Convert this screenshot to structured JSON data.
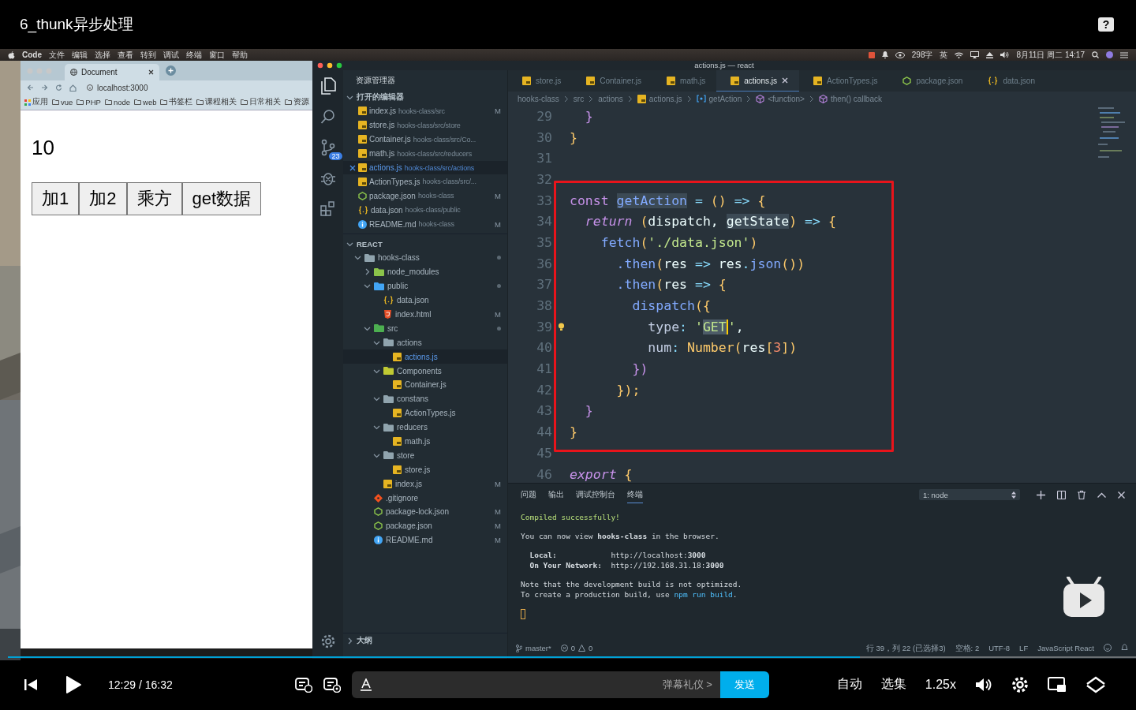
{
  "player": {
    "title": "6_thunk异步处理",
    "help": "?",
    "playing": false,
    "progress": {
      "level": 0.755
    },
    "time": "12:29 / 16:32",
    "danmaku_hint": "弹幕礼仪 >",
    "send": "发送",
    "options": [
      "自动",
      "选集",
      "1.25x"
    ]
  },
  "menubar": {
    "app": "Code",
    "menus": [
      "文件",
      "编辑",
      "选择",
      "查看",
      "转到",
      "调试",
      "终端",
      "窗口",
      "帮助"
    ],
    "word_count": "298字",
    "input_method": "英",
    "clock": "8月11日 周二 14:17"
  },
  "browser": {
    "tab": "Document",
    "url": "localhost:3000",
    "bookmarks": [
      {
        "kind": "apps",
        "label": "应用"
      },
      {
        "kind": "folder",
        "label": "vue"
      },
      {
        "kind": "folder",
        "label": "PHP"
      },
      {
        "kind": "folder",
        "label": "node"
      },
      {
        "kind": "folder",
        "label": "web"
      },
      {
        "kind": "folder",
        "label": "书签栏"
      },
      {
        "kind": "folder",
        "label": "课程相关"
      },
      {
        "kind": "folder",
        "label": "日常相关"
      },
      {
        "kind": "folder",
        "label": "资源"
      }
    ],
    "count": "10",
    "buttons": [
      "加1",
      "加2",
      "乘方",
      "get数据"
    ]
  },
  "vscode": {
    "title": "actions.js — react",
    "source_control_badge": "23",
    "explorer": {
      "title": "资源管理器",
      "open_editors_title": "打开的编辑器",
      "open_editors_expanded": true,
      "open_editors": [
        {
          "name": "index.js",
          "path": "hooks-class/src",
          "kind": "js",
          "status": "M",
          "selected": false
        },
        {
          "name": "store.js",
          "path": "hooks-class/src/store",
          "kind": "js",
          "selected": false
        },
        {
          "name": "Container.js",
          "path": "hooks-class/src/Co...",
          "kind": "js",
          "selected": false
        },
        {
          "name": "math.js",
          "path": "hooks-class/src/reducers",
          "kind": "js",
          "selected": false
        },
        {
          "name": "actions.js",
          "path": "hooks-class/src/actions",
          "kind": "js",
          "selected": true
        },
        {
          "name": "ActionTypes.js",
          "path": "hooks-class/src/...",
          "kind": "js",
          "selected": false
        },
        {
          "name": "package.json",
          "path": "hooks-class",
          "kind": "npm",
          "status": "M",
          "selected": false
        },
        {
          "name": "data.json",
          "path": "hooks-class/public",
          "kind": "data",
          "selected": false
        },
        {
          "name": "README.md",
          "path": "hooks-class",
          "kind": "info",
          "status": "M",
          "selected": false
        }
      ],
      "project_title": "REACT",
      "project_expanded": true,
      "tree": [
        {
          "name": "hooks-class",
          "kind": "folder",
          "color": "#90a4ae",
          "expanded": true,
          "modified": true,
          "selected": false,
          "children": [
            {
              "name": "node_modules",
              "kind": "folder",
              "color": "#8bc34a",
              "expanded": false,
              "modified": false,
              "selected": false
            },
            {
              "name": "public",
              "kind": "folder",
              "color": "#42a5f5",
              "expanded": true,
              "modified": true,
              "selected": false,
              "children": [
                {
                  "name": "data.json",
                  "kind": "data",
                  "selected": false
                },
                {
                  "name": "index.html",
                  "kind": "html",
                  "status": "M",
                  "selected": false
                }
              ]
            },
            {
              "name": "src",
              "kind": "folder",
              "color": "#4caf50",
              "expanded": true,
              "modified": true,
              "selected": false,
              "children": [
                {
                  "name": "actions",
                  "kind": "folder",
                  "color": "#90a4ae",
                  "expanded": true,
                  "modified": false,
                  "selected": false,
                  "children": [
                    {
                      "name": "actions.js",
                      "kind": "js",
                      "selected": true
                    }
                  ]
                },
                {
                  "name": "Components",
                  "kind": "folder",
                  "color": "#c0ca33",
                  "expanded": true,
                  "modified": false,
                  "selected": false,
                  "children": [
                    {
                      "name": "Container.js",
                      "kind": "js",
                      "selected": false
                    }
                  ]
                },
                {
                  "name": "constans",
                  "kind": "folder",
                  "color": "#90a4ae",
                  "expanded": true,
                  "modified": false,
                  "selected": false,
                  "children": [
                    {
                      "name": "ActionTypes.js",
                      "kind": "js",
                      "selected": false
                    }
                  ]
                },
                {
                  "name": "reducers",
                  "kind": "folder",
                  "color": "#90a4ae",
                  "expanded": true,
                  "modified": false,
                  "selected": false,
                  "children": [
                    {
                      "name": "math.js",
                      "kind": "js",
                      "selected": false
                    }
                  ]
                },
                {
                  "name": "store",
                  "kind": "folder",
                  "color": "#90a4ae",
                  "expanded": true,
                  "modified": false,
                  "selected": false,
                  "children": [
                    {
                      "name": "store.js",
                      "kind": "js",
                      "selected": false
                    }
                  ]
                },
                {
                  "name": "index.js",
                  "kind": "js",
                  "status": "M",
                  "selected": false
                }
              ]
            },
            {
              "name": ".gitignore",
              "kind": "git",
              "selected": false
            },
            {
              "name": "package-lock.json",
              "kind": "npm",
              "status": "M",
              "selected": false
            },
            {
              "name": "package.json",
              "kind": "npm",
              "status": "M",
              "selected": false
            },
            {
              "name": "README.md",
              "kind": "info",
              "status": "M",
              "selected": false
            }
          ]
        }
      ],
      "outline_title": "大纲",
      "outline_expanded": false
    },
    "tabs": [
      {
        "name": "store.js",
        "kind": "js",
        "selected": false
      },
      {
        "name": "Container.js",
        "kind": "js",
        "selected": false
      },
      {
        "name": "math.js",
        "kind": "js",
        "selected": false
      },
      {
        "name": "actions.js",
        "kind": "js",
        "selected": true
      },
      {
        "name": "ActionTypes.js",
        "kind": "js",
        "selected": false
      },
      {
        "name": "package.json",
        "kind": "npm",
        "selected": false
      },
      {
        "name": "data.json",
        "kind": "data",
        "selected": false
      }
    ],
    "breadcrumbs": [
      {
        "text": "hooks-class",
        "kind": "plain"
      },
      {
        "text": "src",
        "kind": "plain"
      },
      {
        "text": "actions",
        "kind": "plain"
      },
      {
        "text": "actions.js",
        "kind": "js"
      },
      {
        "text": "getAction",
        "kind": "variable"
      },
      {
        "text": "<function>",
        "kind": "method"
      },
      {
        "text": "then() callback",
        "kind": "method"
      }
    ],
    "code": [
      {
        "number": "29",
        "boxed": false,
        "lightbulb": false,
        "tokens": [
          {
            "kind": "kw",
            "text": "  }"
          }
        ]
      },
      {
        "number": "30",
        "boxed": false,
        "lightbulb": false,
        "tokens": [
          {
            "kind": "br",
            "text": "}"
          }
        ]
      },
      {
        "number": "31",
        "boxed": false,
        "lightbulb": false
      },
      {
        "number": "32",
        "boxed": false,
        "lightbulb": false
      },
      {
        "number": "33",
        "boxed": true,
        "lightbulb": false,
        "tokens": [
          {
            "kind": "kw",
            "text": "const "
          },
          {
            "kind": "hlfn",
            "text": "getAction"
          },
          {
            "kind": "op",
            "text": " = "
          },
          {
            "kind": "br",
            "text": "()"
          },
          {
            "kind": "op",
            "text": " => "
          },
          {
            "kind": "br",
            "text": "{"
          }
        ]
      },
      {
        "number": "34",
        "boxed": true,
        "lightbulb": false,
        "tokens": [
          {
            "kind": "kwi",
            "text": "  return"
          },
          {
            "kind": "br",
            "text": " ("
          },
          {
            "kind": "txt",
            "text": "dispatch, "
          },
          {
            "kind": "hl",
            "text": "getState"
          },
          {
            "kind": "br",
            "text": ")"
          },
          {
            "kind": "op",
            "text": " => "
          },
          {
            "kind": "br",
            "text": "{"
          }
        ]
      },
      {
        "number": "35",
        "boxed": true,
        "lightbulb": false,
        "tokens": [
          {
            "kind": "fn",
            "text": "    fetch"
          },
          {
            "kind": "br",
            "text": "("
          },
          {
            "kind": "str",
            "text": "'./data.json'"
          },
          {
            "kind": "br",
            "text": ")"
          }
        ]
      },
      {
        "number": "36",
        "boxed": true,
        "lightbulb": false,
        "tokens": [
          {
            "kind": "fn",
            "text": "      .then"
          },
          {
            "kind": "br",
            "text": "("
          },
          {
            "kind": "txt",
            "text": "res"
          },
          {
            "kind": "op",
            "text": " => "
          },
          {
            "kind": "txt",
            "text": "res"
          },
          {
            "kind": "op",
            "text": "."
          },
          {
            "kind": "fn",
            "text": "json"
          },
          {
            "kind": "br",
            "text": "())"
          }
        ]
      },
      {
        "number": "37",
        "boxed": true,
        "lightbulb": false,
        "tokens": [
          {
            "kind": "fn",
            "text": "      .then"
          },
          {
            "kind": "br",
            "text": "("
          },
          {
            "kind": "txt",
            "text": "res"
          },
          {
            "kind": "op",
            "text": " => "
          },
          {
            "kind": "br",
            "text": "{"
          }
        ]
      },
      {
        "number": "38",
        "boxed": true,
        "lightbulb": false,
        "tokens": [
          {
            "kind": "fn",
            "text": "        dispatch"
          },
          {
            "kind": "br",
            "text": "({"
          }
        ]
      },
      {
        "number": "39",
        "boxed": true,
        "lightbulb": true,
        "tokens": [
          {
            "kind": "prop",
            "text": "          type"
          },
          {
            "kind": "op",
            "text": ": "
          },
          {
            "kind": "str",
            "text": "'"
          },
          {
            "kind": "sel",
            "text": "GET"
          },
          {
            "kind": "str",
            "text": "'"
          },
          {
            "kind": "txt",
            "text": ","
          }
        ]
      },
      {
        "number": "40",
        "boxed": true,
        "lightbulb": false,
        "tokens": [
          {
            "kind": "prop",
            "text": "          num"
          },
          {
            "kind": "op",
            "text": ": "
          },
          {
            "kind": "br",
            "text": "Number("
          },
          {
            "kind": "txt",
            "text": "res"
          },
          {
            "kind": "br",
            "text": "["
          },
          {
            "kind": "num",
            "text": "3"
          },
          {
            "kind": "br",
            "text": "])"
          }
        ]
      },
      {
        "number": "41",
        "boxed": true,
        "lightbulb": false,
        "tokens": [
          {
            "kind": "kw",
            "text": "        })"
          }
        ]
      },
      {
        "number": "42",
        "boxed": true,
        "lightbulb": false,
        "tokens": [
          {
            "kind": "br",
            "text": "      });"
          }
        ]
      },
      {
        "number": "43",
        "boxed": true,
        "lightbulb": false,
        "tokens": [
          {
            "kind": "kw",
            "text": "  }"
          }
        ]
      },
      {
        "number": "44",
        "boxed": true,
        "lightbulb": false,
        "tokens": [
          {
            "kind": "br",
            "text": "}"
          }
        ]
      },
      {
        "number": "45",
        "boxed": false,
        "lightbulb": false
      },
      {
        "number": "46",
        "boxed": false,
        "lightbulb": false,
        "tokens": [
          {
            "kind": "kwi",
            "text": "export"
          },
          {
            "kind": "br",
            "text": " {"
          }
        ]
      }
    ],
    "panel": {
      "tabs": [
        {
          "label": "问题",
          "selected": false
        },
        {
          "label": "输出",
          "selected": false
        },
        {
          "label": "调试控制台",
          "selected": false
        },
        {
          "label": "终端",
          "selected": true
        }
      ],
      "terminal_select": "1: node",
      "lines": [
        {
          "gap": false,
          "segments": [
            {
              "kind": "ok",
              "text": "Compiled successfully!"
            }
          ]
        },
        {
          "gap": true,
          "segments": [
            {
              "kind": "plain",
              "text": "You can now view "
            },
            {
              "kind": "bold",
              "text": "hooks-class"
            },
            {
              "kind": "plain",
              "text": " in the browser."
            }
          ]
        },
        {
          "gap": true,
          "segments": [
            {
              "kind": "bold",
              "text": "  Local:            "
            },
            {
              "kind": "plain",
              "text": "http://localhost:"
            },
            {
              "kind": "bold",
              "text": "3000"
            }
          ]
        },
        {
          "gap": false,
          "segments": [
            {
              "kind": "bold",
              "text": "  On Your Network:  "
            },
            {
              "kind": "plain",
              "text": "http://192.168.31.18:"
            },
            {
              "kind": "bold",
              "text": "3000"
            }
          ]
        },
        {
          "gap": true,
          "segments": [
            {
              "kind": "plain",
              "text": "Note that the development build is not optimized."
            }
          ]
        },
        {
          "gap": false,
          "segments": [
            {
              "kind": "plain",
              "text": "To create a production build, use "
            },
            {
              "kind": "cmd",
              "text": "npm run build"
            },
            {
              "kind": "plain",
              "text": "."
            }
          ]
        }
      ]
    },
    "status_bar": {
      "branch": "master*",
      "errors": "0",
      "warnings": "0",
      "items": [
        "行 39，列 22 (已选择3)",
        "空格: 2",
        "UTF-8",
        "LF",
        "JavaScript React"
      ]
    }
  }
}
